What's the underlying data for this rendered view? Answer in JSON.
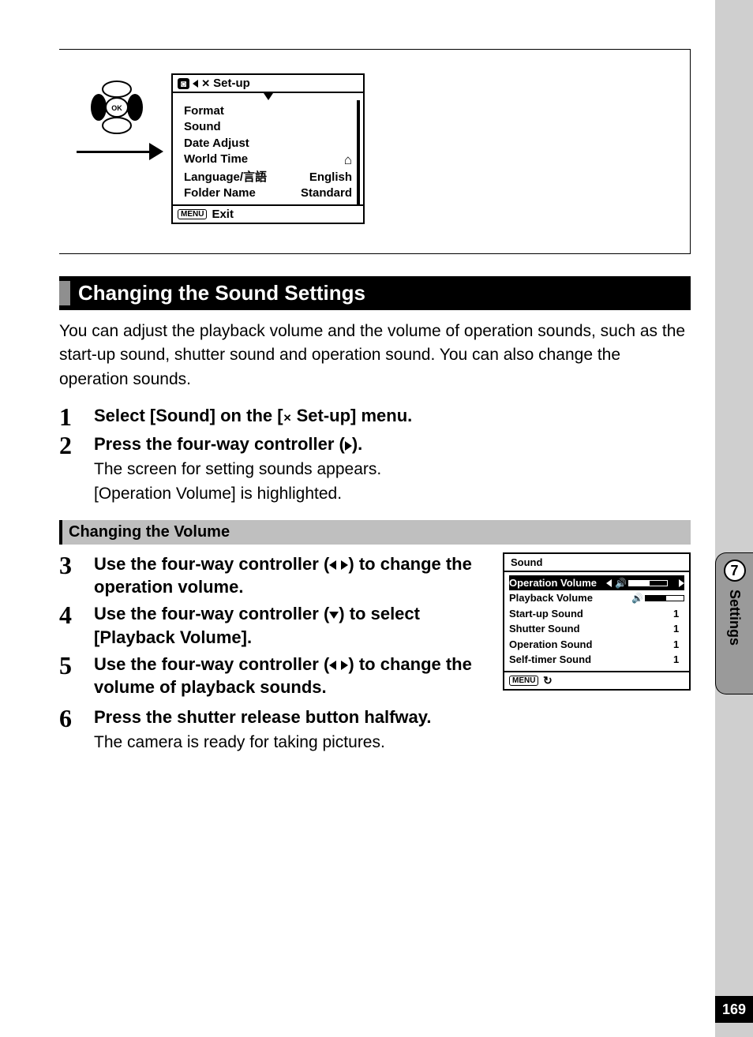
{
  "page_number": "169",
  "side_tab": {
    "number": "7",
    "label": "Settings"
  },
  "setup_menu": {
    "title": "Set-up",
    "items": [
      {
        "label": "Format",
        "value": ""
      },
      {
        "label": "Sound",
        "value": ""
      },
      {
        "label": "Date Adjust",
        "value": ""
      },
      {
        "label": "World Time",
        "value": "",
        "icon": "home"
      },
      {
        "label": "Language/",
        "value": "English",
        "suffix": "言語"
      },
      {
        "label": "Folder Name",
        "value": "Standard"
      }
    ],
    "exit": "Exit",
    "menu_btn": "MENU"
  },
  "section_title": "Changing the Sound Settings",
  "intro": "You can adjust the playback volume and the volume of operation sounds, such as the start-up sound, shutter sound and operation sound. You can also change the operation sounds.",
  "steps_a": [
    {
      "n": "1",
      "title_pre": "Select [Sound] on the [",
      "title_post": " Set-up] menu."
    },
    {
      "n": "2",
      "title": "Press the four-way controller (",
      "title_post": ").",
      "desc1": "The screen for setting sounds appears.",
      "desc2": "[Operation Volume] is highlighted."
    }
  ],
  "subheader": "Changing the Volume",
  "steps_b": [
    {
      "n": "3",
      "title_pre": "Use the four-way controller (",
      "title_post": ") to change the operation volume."
    },
    {
      "n": "4",
      "title_pre": "Use the four-way controller (",
      "title_post": ") to select [Playback Volume]."
    },
    {
      "n": "5",
      "title_pre": "Use the four-way controller (",
      "title_post": ") to change the volume of playback sounds."
    },
    {
      "n": "6",
      "title": "Press the shutter release button halfway.",
      "desc": "The camera is ready for taking pictures."
    }
  ],
  "sound_lcd": {
    "title": "Sound",
    "rows": [
      {
        "label": "Operation Volume",
        "type": "vol",
        "fill": 55,
        "hl": true
      },
      {
        "label": "Playback Volume",
        "type": "vol",
        "fill": 55
      },
      {
        "label": "Start-up Sound",
        "type": "val",
        "value": "1"
      },
      {
        "label": "Shutter Sound",
        "type": "val",
        "value": "1"
      },
      {
        "label": "Operation Sound",
        "type": "val",
        "value": "1"
      },
      {
        "label": "Self-timer Sound",
        "type": "val",
        "value": "1"
      }
    ],
    "menu_btn": "MENU"
  }
}
